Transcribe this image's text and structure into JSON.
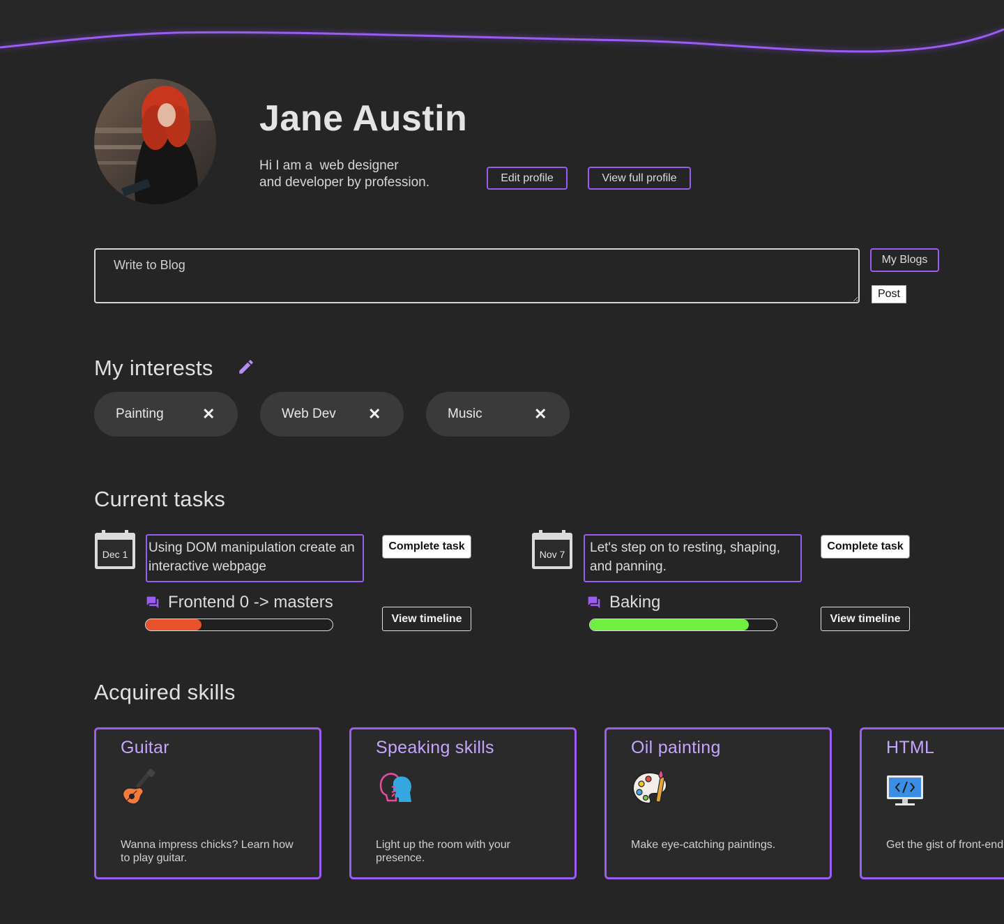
{
  "profile": {
    "name": "Jane Austin",
    "bio_line1": "Hi I am a  web designer",
    "bio_line2": "and developer by profession.",
    "edit_label": "Edit profile",
    "view_full_label": "View full profile"
  },
  "blog": {
    "placeholder": "Write to Blog",
    "my_blogs_label": "My Blogs",
    "post_label": "Post"
  },
  "interests": {
    "title": "My interests",
    "items": [
      {
        "label": "Painting"
      },
      {
        "label": "Web Dev"
      },
      {
        "label": "Music"
      }
    ],
    "remove_symbol": "✕"
  },
  "tasks": {
    "title": "Current tasks",
    "items": [
      {
        "date": "Dec 1",
        "description": "Using DOM manipulation create an interactive webpage",
        "complete_label": "Complete task",
        "timeline_label": "View timeline",
        "project": "Frontend 0 -> masters",
        "progress": 0.3,
        "progress_color": "#e8532b"
      },
      {
        "date": "Nov 7",
        "description": "Let's step on to resting, shaping, and panning.",
        "complete_label": "Complete task",
        "timeline_label": "View timeline",
        "project": "Baking",
        "progress": 0.85,
        "progress_color": "#6fef3f"
      }
    ]
  },
  "skills": {
    "title": "Acquired skills",
    "items": [
      {
        "title": "Guitar",
        "icon": "guitar-icon",
        "description": "Wanna impress chicks? Learn how to play guitar."
      },
      {
        "title": "Speaking skills",
        "icon": "speaking-heads-icon",
        "description": "Light up the room with your presence."
      },
      {
        "title": "Oil painting",
        "icon": "palette-icon",
        "description": "Make eye-catching paintings."
      },
      {
        "title": "HTML",
        "icon": "monitor-code-icon",
        "description": "Get the gist of front-end"
      }
    ]
  },
  "colors": {
    "accent": "#9b5cf0",
    "background": "#252525",
    "chip": "#3a3a3a"
  }
}
